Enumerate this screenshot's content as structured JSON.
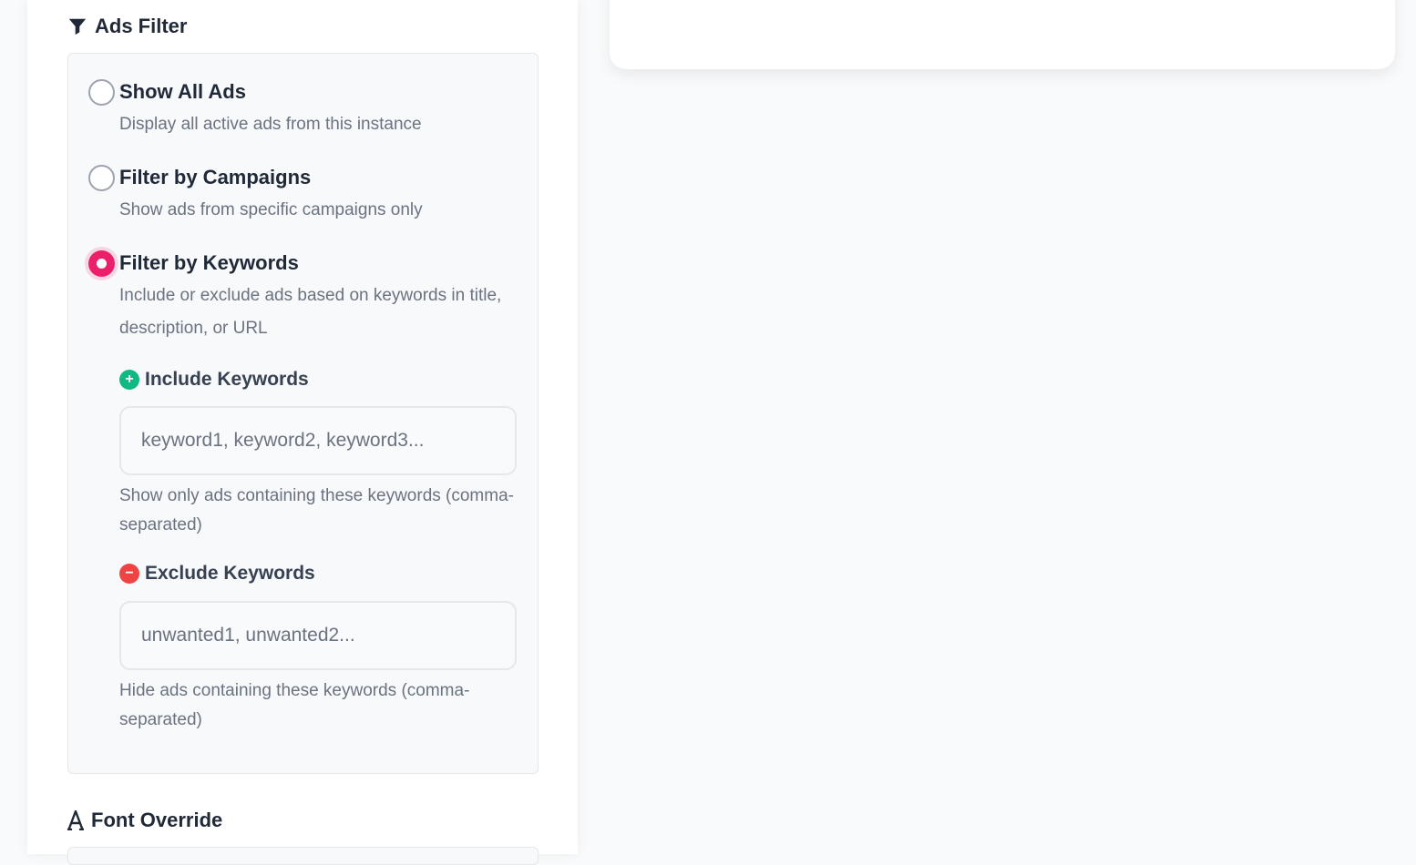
{
  "ads_filter": {
    "title": "Ads Filter",
    "icon": "filter-icon",
    "options": [
      {
        "label": "Show All Ads",
        "description": "Display all active ads from this instance",
        "selected": false
      },
      {
        "label": "Filter by Campaigns",
        "description": "Show ads from specific campaigns only",
        "selected": false
      },
      {
        "label": "Filter by Keywords",
        "description": "Include or exclude ads based on keywords in title, description, or URL",
        "selected": true
      }
    ],
    "include": {
      "label": "Include Keywords",
      "icon": "plus-circle-icon",
      "placeholder": "keyword1, keyword2, keyword3...",
      "value": "",
      "help": "Show only ads containing these keywords (comma-separated)"
    },
    "exclude": {
      "label": "Exclude Keywords",
      "icon": "minus-circle-icon",
      "placeholder": "unwanted1, unwanted2...",
      "value": "",
      "help": "Hide ads containing these keywords (comma-separated)"
    }
  },
  "font_override": {
    "title": "Font Override",
    "icon": "font-icon"
  },
  "colors": {
    "accent": "#ec1f6a",
    "include_green": "#10b981",
    "exclude_red": "#ef4444"
  }
}
